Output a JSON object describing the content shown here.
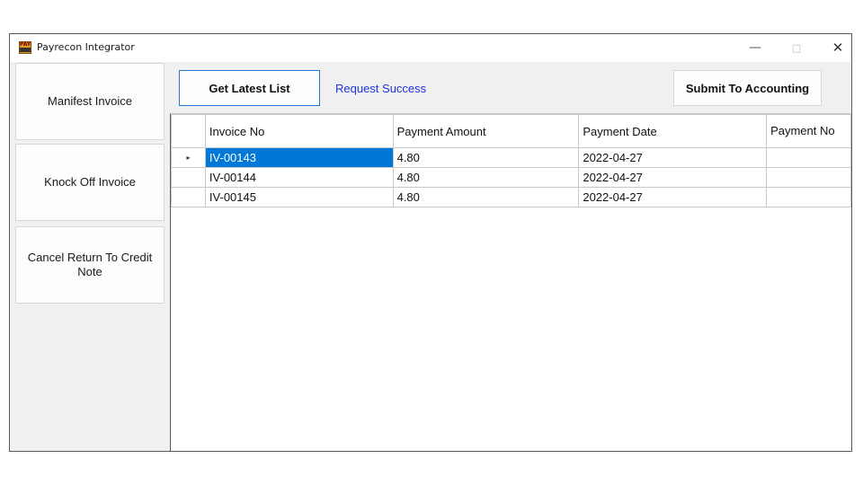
{
  "window": {
    "title": "Payrecon Integrator",
    "icon": "payrecon-app-icon",
    "controls": {
      "minimize": "—",
      "maximize": "□",
      "close": "✕"
    }
  },
  "sidebar": {
    "items": [
      {
        "label": "Manifest Invoice"
      },
      {
        "label": "Knock Off Invoice"
      },
      {
        "label": "Cancel Return To Credit Note"
      }
    ]
  },
  "toolbar": {
    "get_latest_label": "Get Latest List",
    "status": "Request Success",
    "submit_label": "Submit To Accounting"
  },
  "grid": {
    "columns": [
      "Invoice No",
      "Payment Amount",
      "Payment Date",
      "Payment No"
    ],
    "rows": [
      {
        "invoice_no": "IV-00143",
        "payment_amount": "4.80",
        "payment_date": "2022-04-27",
        "payment_no": "",
        "selected": true
      },
      {
        "invoice_no": "IV-00144",
        "payment_amount": "4.80",
        "payment_date": "2022-04-27",
        "payment_no": "",
        "selected": false
      },
      {
        "invoice_no": "IV-00145",
        "payment_amount": "4.80",
        "payment_date": "2022-04-27",
        "payment_no": "",
        "selected": false
      }
    ],
    "current_row_marker": "▸"
  },
  "colors": {
    "selection": "#0078d7",
    "status_text": "#1f33e0",
    "focus_border": "#1e7ad4"
  }
}
